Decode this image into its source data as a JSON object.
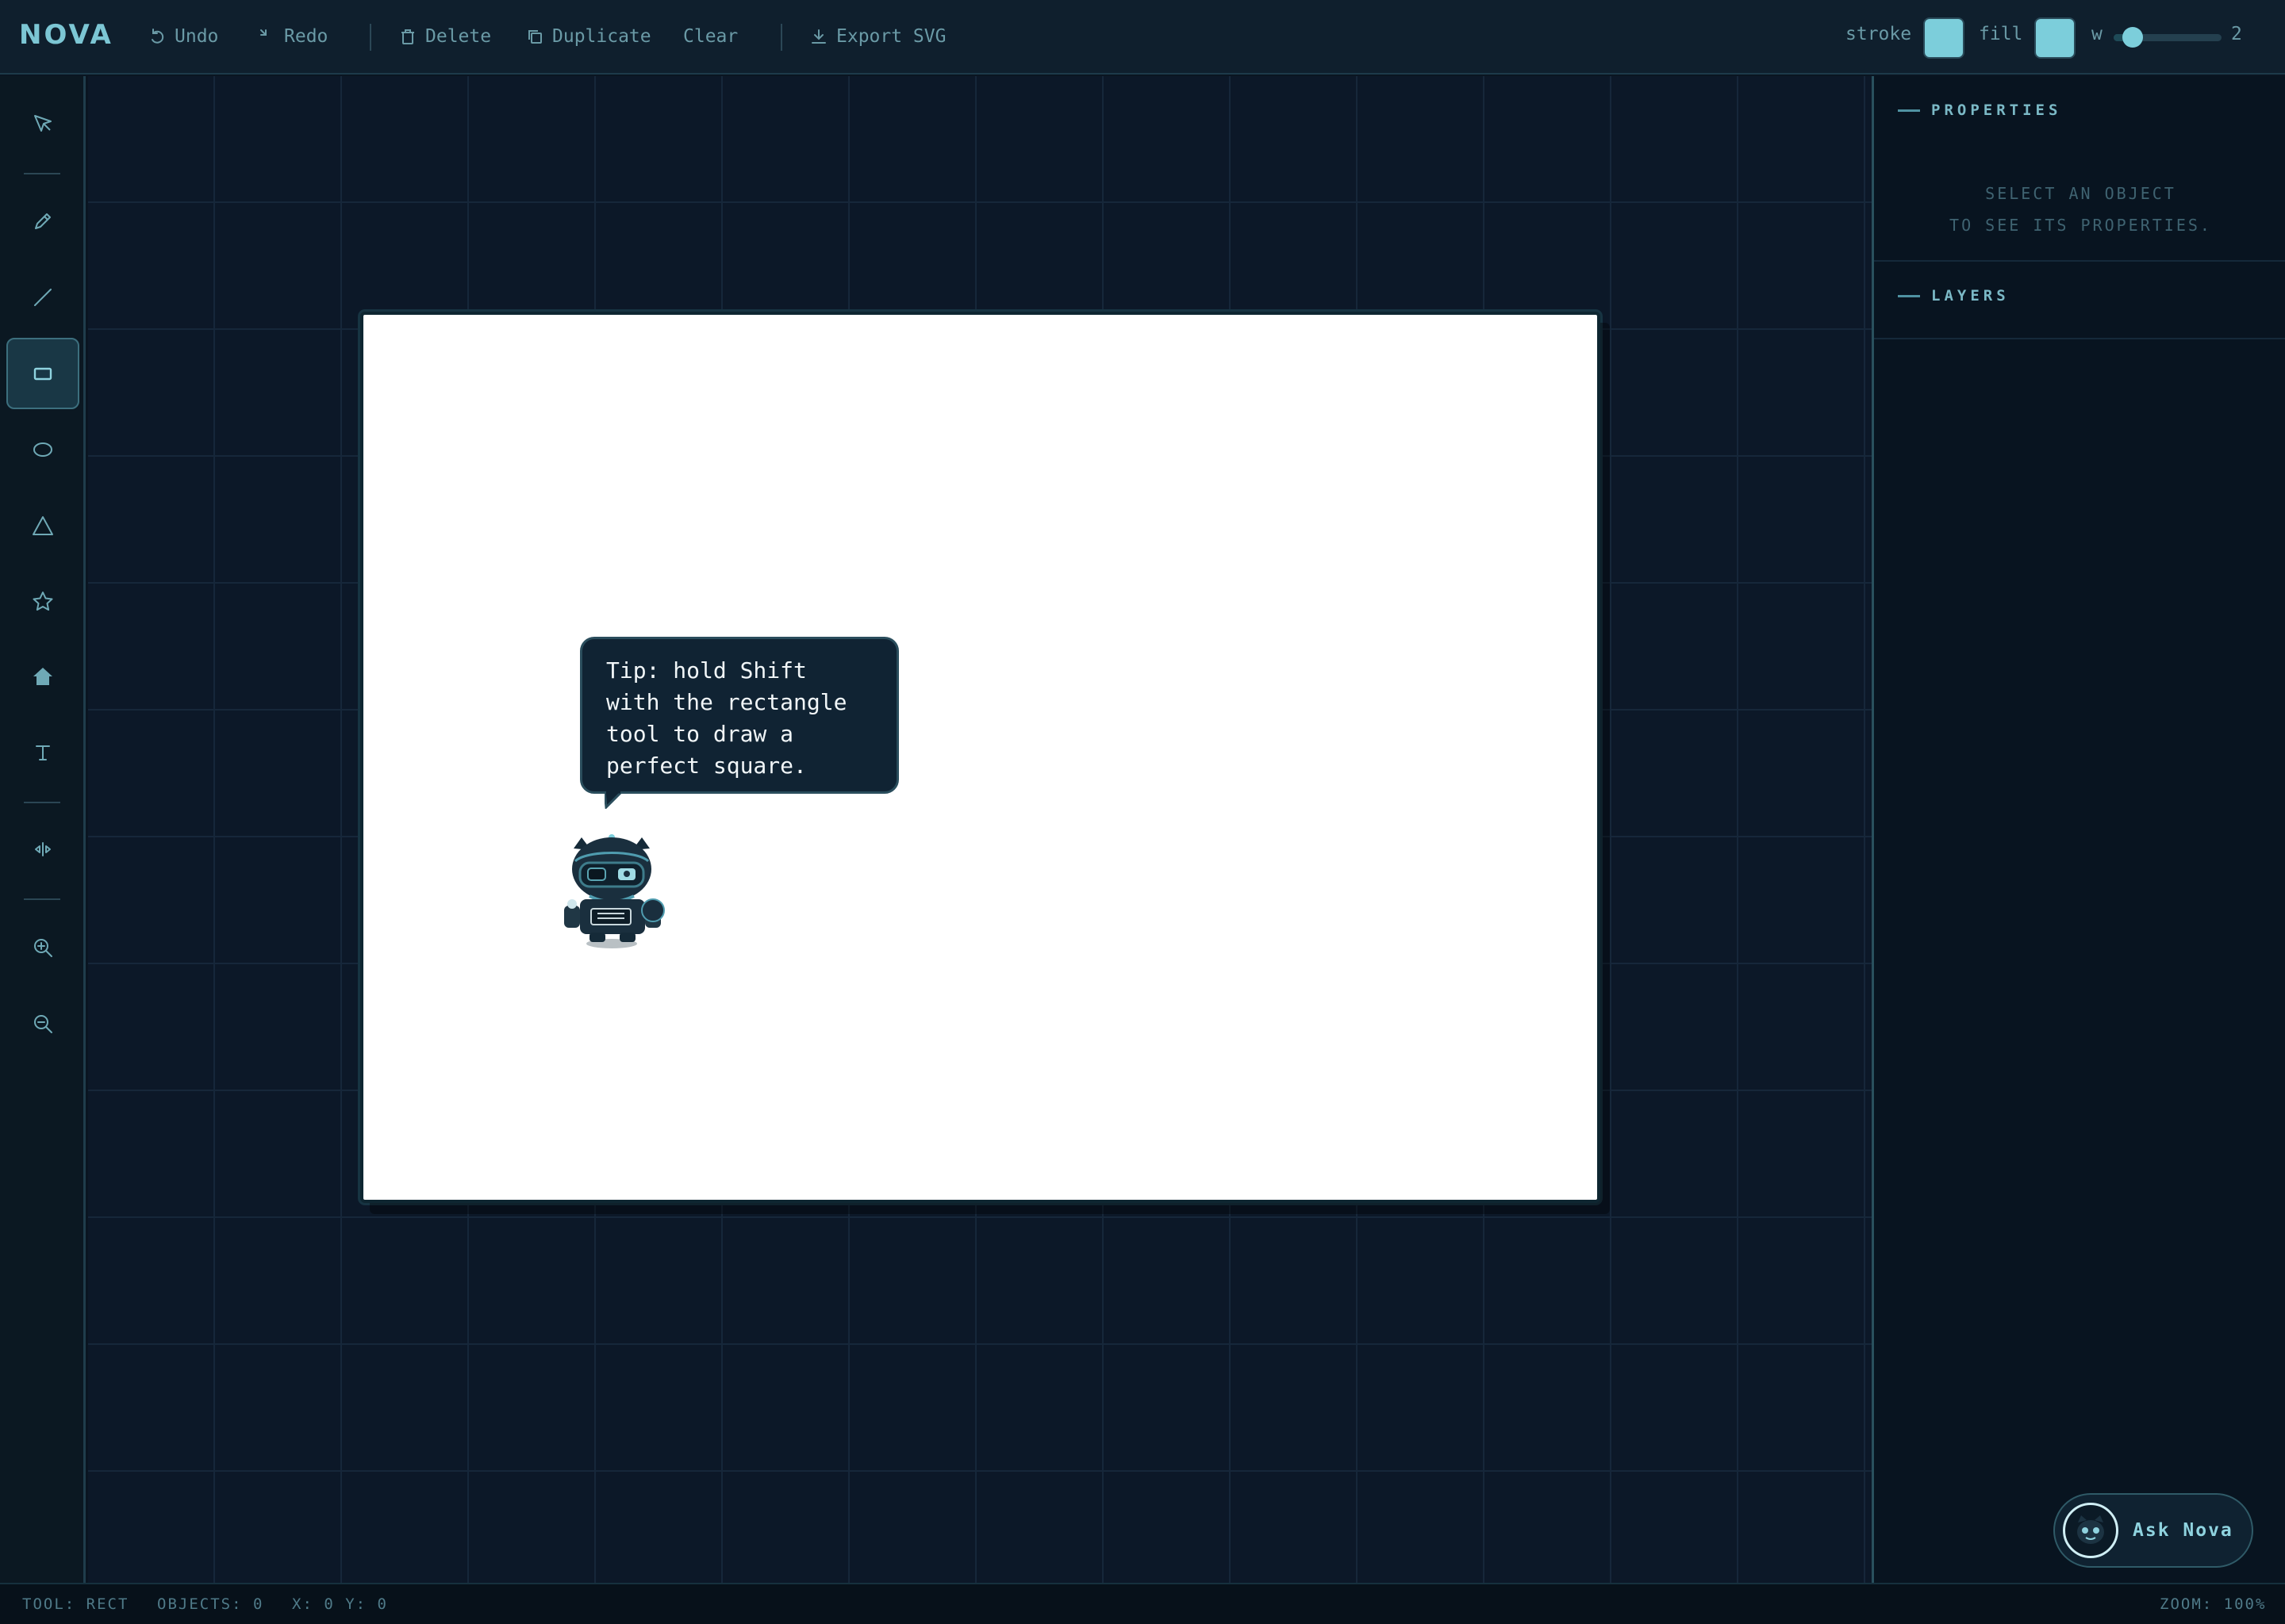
{
  "app": {
    "name": "NOVA"
  },
  "toolbar": {
    "undo_label": "Undo",
    "redo_label": "Redo",
    "delete_label": "Delete",
    "duplicate_label": "Duplicate",
    "clear_label": "Clear",
    "export_label": "Export SVG",
    "stroke_label": "stroke",
    "fill_label": "fill",
    "width_label": "w",
    "width_value": "2",
    "width_level": 0.1,
    "stroke_color": "#7ccedb",
    "fill_color": "#7ccedb"
  },
  "tools": [
    {
      "id": "select",
      "icon": "select-arrow-icon"
    },
    {
      "id": "pencil",
      "icon": "pencil-icon"
    },
    {
      "id": "line",
      "icon": "line-icon"
    },
    {
      "id": "rect",
      "icon": "rectangle-icon",
      "active": true
    },
    {
      "id": "ellipse",
      "icon": "ellipse-icon"
    },
    {
      "id": "triangle",
      "icon": "triangle-icon"
    },
    {
      "id": "star",
      "icon": "star-icon"
    },
    {
      "id": "house",
      "icon": "house-icon"
    },
    {
      "id": "text",
      "icon": "text-icon"
    },
    {
      "id": "flip",
      "icon": "flip-horizontal-icon"
    },
    {
      "id": "zoom-in",
      "icon": "zoom-in-icon"
    },
    {
      "id": "zoom-out",
      "icon": "zoom-out-icon"
    }
  ],
  "canvas": {
    "tip": "Tip: hold Shift with the rectangle tool to draw a perfect square."
  },
  "panel": {
    "properties_title": "PROPERTIES",
    "properties_empty_line1": "SELECT AN OBJECT",
    "properties_empty_line2": "TO SEE ITS PROPERTIES.",
    "layers_title": "LAYERS"
  },
  "assistant": {
    "label": "Ask Nova"
  },
  "status": {
    "tool": "TOOL: RECT",
    "objects": "OBJECTS: 0",
    "coords": "X: 0 Y: 0",
    "zoom": "ZOOM: 100%"
  },
  "colors": {
    "accent": "#7ccedb",
    "panel_bg": "#081420",
    "canvas_bg": "#ffffff"
  }
}
